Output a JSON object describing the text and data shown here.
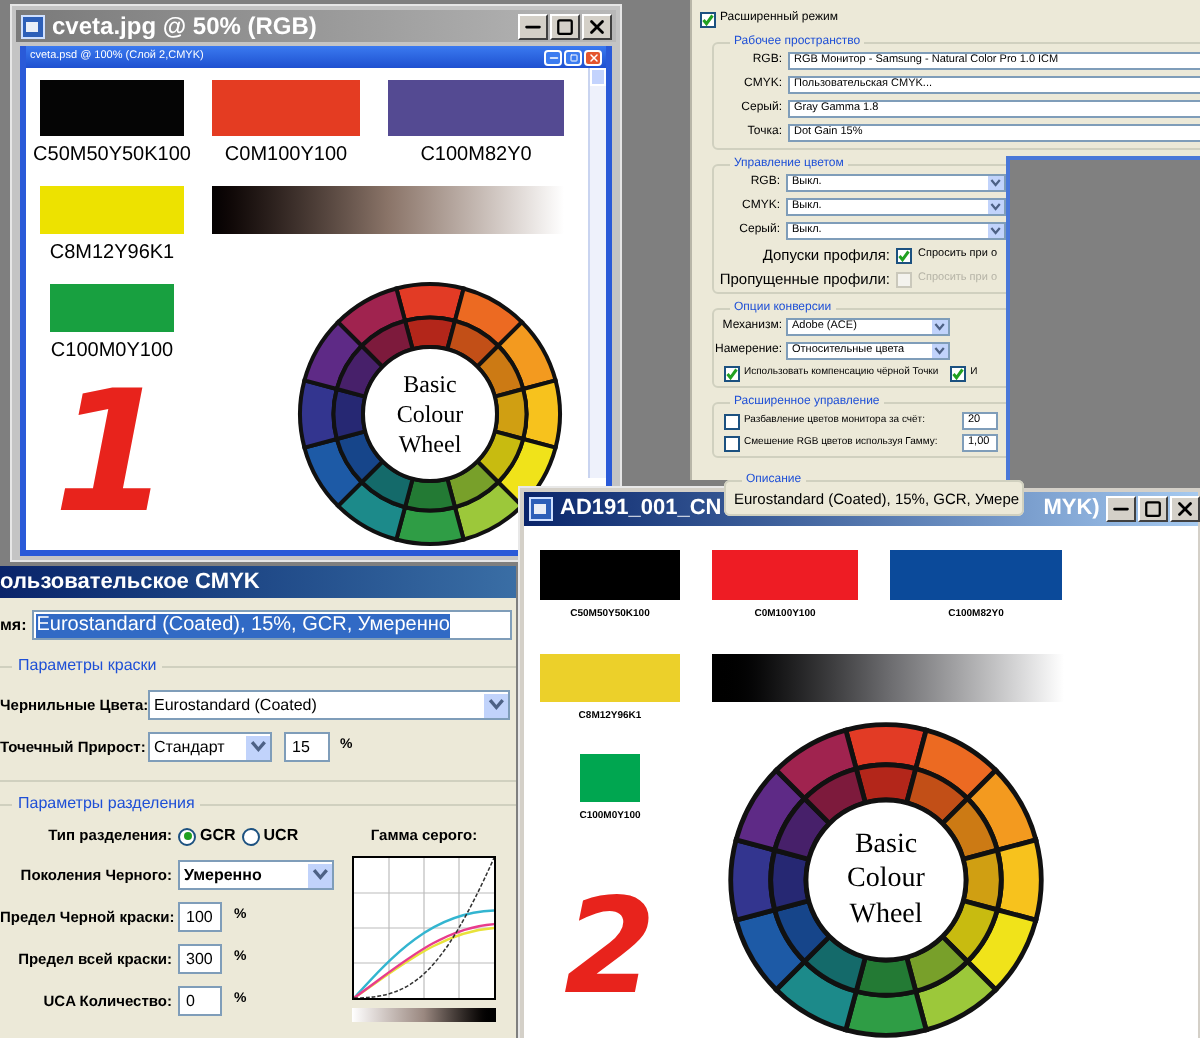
{
  "doc_1": {
    "window_title": "cveta.jpg @ 50% (RGB)",
    "document_title": "cveta.psd @ 100% (Слой 2,CMYK)",
    "swatches": [
      {
        "label": "C50M50Y50K100",
        "color": "#050505"
      },
      {
        "label": "C0M100Y100",
        "color": "#e43c22"
      },
      {
        "label": "C100M82Y0",
        "color": "#544a92"
      },
      {
        "label": "C8M12Y96K1",
        "color": "#ede200"
      },
      {
        "label": "C100M0Y100",
        "color": "#18a040"
      }
    ],
    "wheel_label": "Basic Colour Wheel",
    "numeral": "1"
  },
  "color_settings": {
    "advanced_mode": {
      "label": "Расширенный режим",
      "checked": true
    },
    "working_spaces": {
      "legend": "Рабочее пространство",
      "rows": [
        {
          "label": "RGB:",
          "value": "RGB Монитор - Samsung - Natural Color Pro 1.0 ICM"
        },
        {
          "label": "CMYK:",
          "value": "Пользовательская CMYK..."
        },
        {
          "label": "Серый:",
          "value": "Gray Gamma 1.8"
        },
        {
          "label": "Точка:",
          "value": "Dot Gain 15%"
        }
      ]
    },
    "color_management": {
      "legend": "Управление цветом",
      "rows": [
        {
          "label": "RGB:",
          "value": "Выкл."
        },
        {
          "label": "CMYK:",
          "value": "Выкл."
        },
        {
          "label": "Серый:",
          "value": "Выкл."
        }
      ],
      "checks": [
        {
          "label": "Допуски профиля:",
          "option": "Спросить при о",
          "checked": true,
          "disabled": false
        },
        {
          "label": "Пропущенные профили:",
          "option": "Спросить при о",
          "checked": false,
          "disabled": true
        }
      ]
    },
    "conversion": {
      "legend": "Опции конверсии",
      "rows": [
        {
          "label": "Механизм:",
          "value": "Adobe (ACE)"
        },
        {
          "label": "Намерение:",
          "value": "Относительные цвета"
        }
      ],
      "checks": [
        {
          "label": "Использовать компенсацию чёрной Точки",
          "checked": true
        },
        {
          "label": "И",
          "checked": true
        }
      ]
    },
    "advanced": {
      "legend": "Расширенное управление",
      "rows": [
        {
          "label": "Разбавление цветов монитора за счёт:",
          "value": "20",
          "checked": false
        },
        {
          "label": "Смешение RGB цветов используя Гамму:",
          "value": "1,00",
          "checked": false
        }
      ]
    },
    "description": {
      "legend": "Описание",
      "text": "Eurostandard (Coated), 15%, GCR, Умере"
    }
  },
  "custom_cmyk_dialog": {
    "title": "ользовательское CMYK",
    "name_label": "мя:",
    "name_value": "Eurostandard (Coated), 15%, GCR, Умеренно",
    "name_text_selected": true,
    "ink_legend": "Параметры краски",
    "ink_colors": {
      "label": "Чернильные Цвета:",
      "value": "Eurostandard (Coated)"
    },
    "dot_gain": {
      "label": "Точечный Прирост:",
      "value": "Стандарт",
      "amount": "15",
      "unit": "%"
    },
    "separation_legend": "Параметры разделения",
    "separation_type": {
      "label": "Тип разделения:",
      "options": [
        {
          "label": "GCR",
          "selected": true
        },
        {
          "label": "UCR",
          "selected": false
        }
      ]
    },
    "gray_ramp_label": "Гамма серого:",
    "black_generation": {
      "label": "Поколения Черного:",
      "value": "Умеренно"
    },
    "limits": [
      {
        "label": "Предел Черной краски:",
        "value": "100",
        "unit": "%"
      },
      {
        "label": "Предел всей краски:",
        "value": "300",
        "unit": "%"
      },
      {
        "label": "UCA Количество:",
        "value": "0",
        "unit": "%"
      }
    ]
  },
  "doc_2": {
    "title_parts": [
      "AD191_001_CN",
      "MYK)"
    ],
    "swatches": [
      {
        "label": "C50M50Y50K100",
        "color": "#000000"
      },
      {
        "label": "C0M100Y100",
        "color": "#ee1c24"
      },
      {
        "label": "C100M82Y0",
        "color": "#0b4a9a"
      },
      {
        "label": "C8M12Y96K1",
        "color": "#ecd02a"
      },
      {
        "label": "C100M0Y100",
        "color": "#00a650"
      }
    ],
    "wheel_label": "Basic Colour Wheel",
    "numeral": "2"
  }
}
